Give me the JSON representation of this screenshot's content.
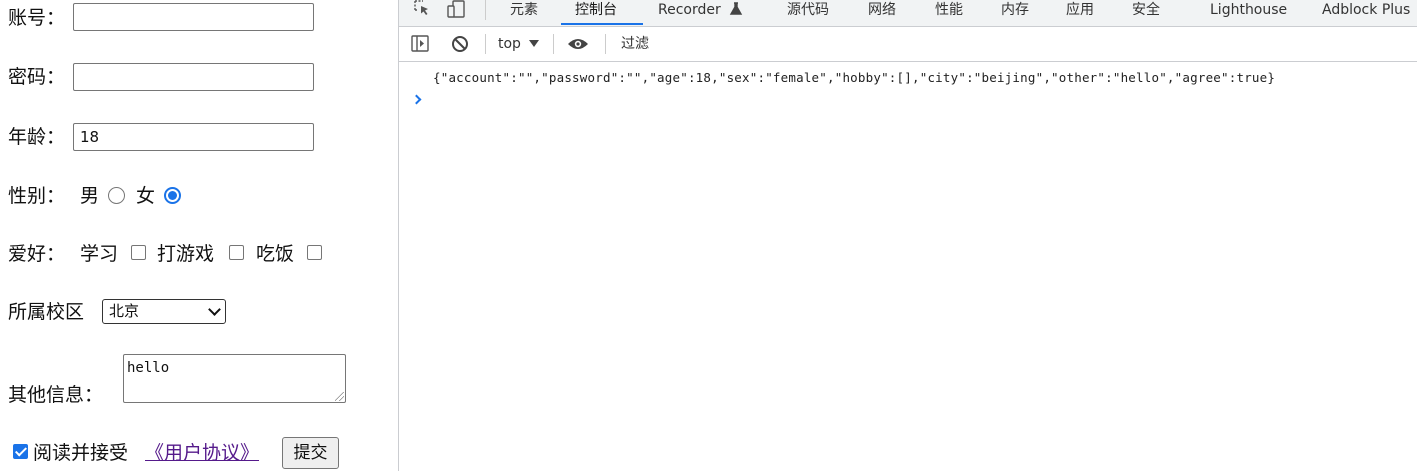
{
  "form": {
    "account_label": "账号：",
    "account_value": "",
    "password_label": "密码：",
    "password_value": "",
    "age_label": "年龄：",
    "age_value": "18",
    "sex_label": "性别：",
    "sex_male": "男",
    "sex_female": "女",
    "hobby_label": "爱好：",
    "hobby_study": "学习",
    "hobby_game": "打游戏",
    "hobby_eat": "吃饭",
    "campus_label": "所属校区",
    "campus_selected": "北京",
    "other_label": "其他信息：",
    "other_value": "hello",
    "agree_text": "阅读并接受",
    "agree_link": "《用户协议》",
    "submit_label": "提交"
  },
  "devtools": {
    "tabs": [
      "元素",
      "控制台",
      "Recorder",
      "源代码",
      "网络",
      "性能",
      "内存",
      "应用",
      "安全",
      "Lighthouse",
      "Adblock Plus"
    ],
    "active_tab": "控制台",
    "context": "top",
    "filter_placeholder": "过滤",
    "console_output": "{\"account\":\"\",\"password\":\"\",\"age\":18,\"sex\":\"female\",\"hobby\":[],\"city\":\"beijing\",\"other\":\"hello\",\"agree\":true}"
  }
}
